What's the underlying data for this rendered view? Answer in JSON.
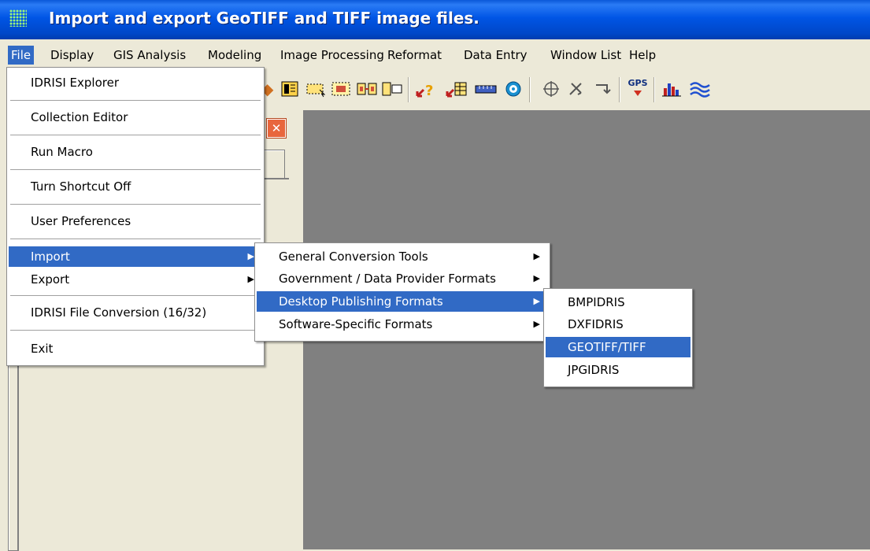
{
  "window": {
    "title": "Import and export GeoTIFF and TIFF image files."
  },
  "menubar": {
    "items": [
      "File",
      "Display",
      "GIS Analysis",
      "Modeling",
      "Image Processing",
      "Reformat",
      "Data Entry",
      "Window List",
      "Help"
    ],
    "active": "File"
  },
  "file_menu": {
    "items": [
      {
        "label": "IDRISI Explorer"
      },
      {
        "label": "Collection Editor"
      },
      {
        "label": "Run Macro"
      },
      {
        "label": "Turn Shortcut Off"
      },
      {
        "label": "User Preferences"
      },
      {
        "label": "Import",
        "submenu": true,
        "highlighted": true
      },
      {
        "label": "Export",
        "submenu": true
      },
      {
        "label": "IDRISI File Conversion (16/32)"
      },
      {
        "label": "Exit"
      }
    ]
  },
  "import_menu": {
    "items": [
      {
        "label": "General Conversion Tools",
        "submenu": true
      },
      {
        "label": "Government / Data Provider Formats",
        "submenu": true
      },
      {
        "label": "Desktop Publishing Formats",
        "submenu": true,
        "highlighted": true
      },
      {
        "label": "Software-Specific Formats",
        "submenu": true
      }
    ]
  },
  "dtp_menu": {
    "items": [
      {
        "label": "BMPIDRIS"
      },
      {
        "label": "DXFIDRIS"
      },
      {
        "label": "GEOTIFF/TIFF",
        "highlighted": true
      },
      {
        "label": "JPGIDRIS"
      }
    ]
  },
  "toolbar": {
    "gps_label": "GPS",
    "icons": [
      "layer-icon",
      "composite-icon",
      "select-icon",
      "zoom-window-icon",
      "link-icon",
      "group-icon",
      "query-icon",
      "attribute-icon",
      "measure-icon",
      "target-icon",
      "crosshair-icon",
      "tools-icon",
      "arrow-icon",
      "gps-icon",
      "histogram-icon",
      "wave-icon"
    ]
  },
  "colors": {
    "highlight": "#316ac5",
    "titlebar": "#0054e3",
    "workspace": "#808080"
  }
}
